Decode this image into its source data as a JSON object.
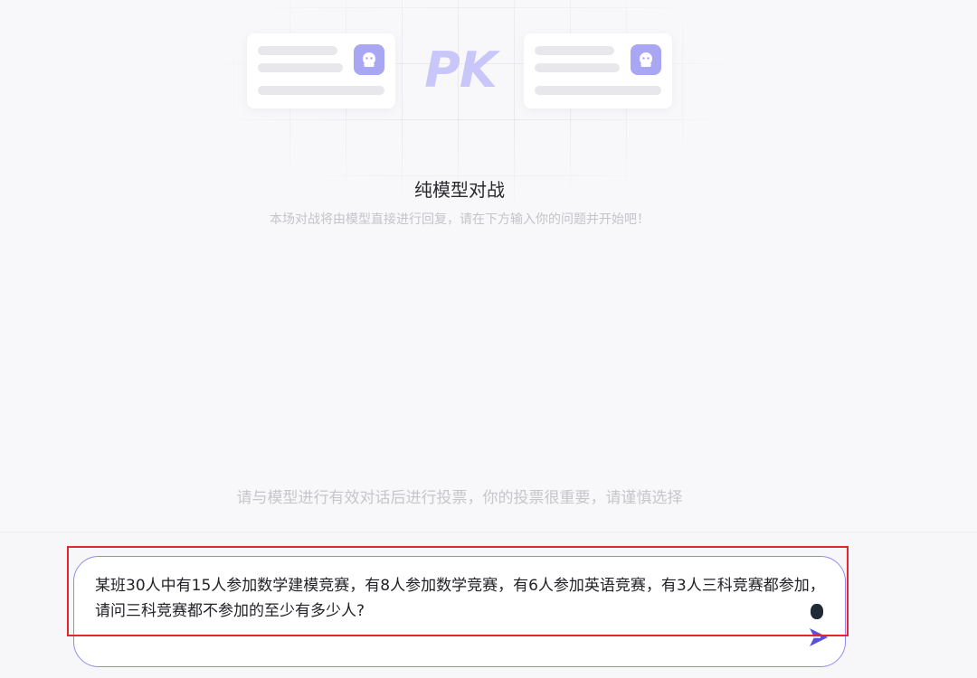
{
  "hero": {
    "pk_text": "PK",
    "title": "纯模型对战",
    "subtitle": "本场对战将由模型直接进行回复，请在下方输入你的问题并开始吧！"
  },
  "vote_hint": "请与模型进行有效对话后进行投票，你的投票很重要，请谨慎选择",
  "input": {
    "value": "某班30人中有15人参加数学建模竞赛，有8人参加数学竞赛，有6人参加英语竞赛，有3人三科竞赛都参加，请问三科竞赛都不参加的至少有多少人?"
  },
  "colors": {
    "accent": "#8f8cf0",
    "send_icon": "#5b4fe0",
    "highlight_border": "#e6262a",
    "avatar": "#a9a6f3"
  },
  "icons": {
    "avatar": "bot-avatar-icon",
    "send": "send-arrow-icon"
  }
}
